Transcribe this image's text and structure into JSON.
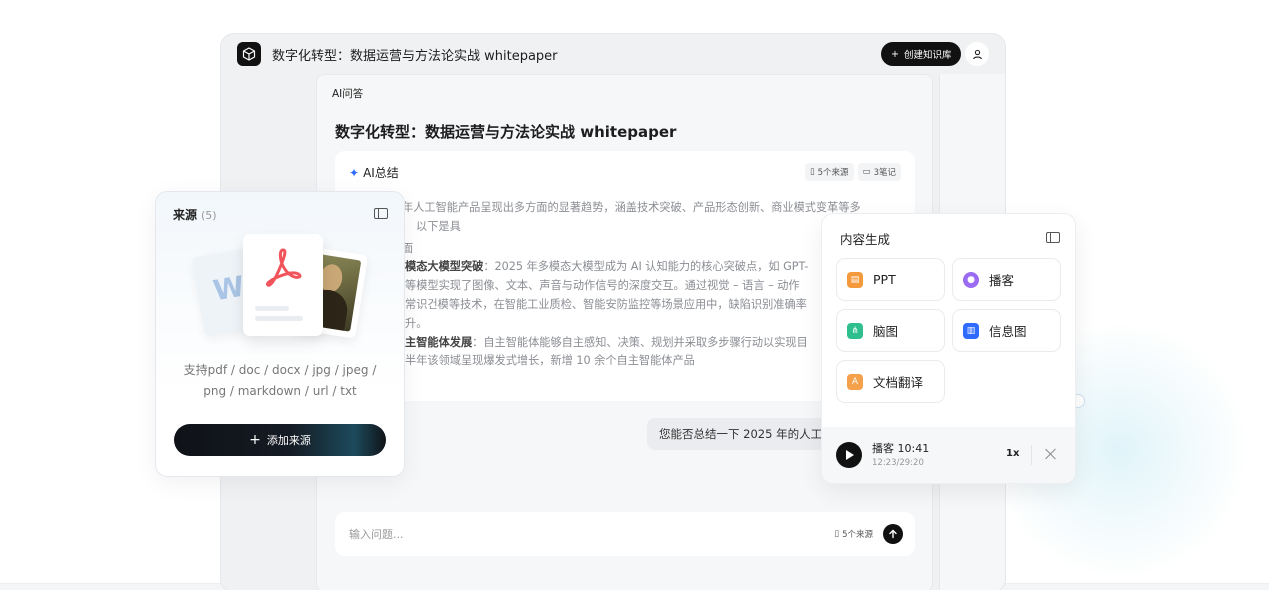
{
  "window": {
    "title": "数字化转型：数据运营与方法论实战 whitepaper",
    "create_button": "创建知识库"
  },
  "center": {
    "tab": "AI问答",
    "title": "数字化转型：数据运营与方法论实战 whitepaper",
    "summary": {
      "heading": "AI总结",
      "sources_pill": "5个来源",
      "notes_pill": "3笔记",
      "line1": "年人工智能产品呈现出多方面的显著趋势，涵盖技术突破、产品形态创新、商业模式变革等多",
      "line2": "以下是具",
      "line3": "面",
      "line4_bold": "模态大模型突破",
      "line4": "：2025 年多模态大模型成为 AI 认知能力的核心突破点，如 GPT-",
      "line5": "等模型实现了图像、文本、声音与动作信号的深度交互。通过视觉 – 语言 – 动作",
      "line6": "常识건模等技术，在智能工业质检、智能安防监控等场景应用中，缺陷识别准确率",
      "line7": "升。",
      "line8_bold": "主智能体发展",
      "line8": "：自主智能体能够自主感知、决策、规划并采取多步骤行动以实现目",
      "line9": "半年该领域呈现爆发式增长，新增 10 余个自主智能体产品"
    },
    "question": "您能否总结一下 2025 年的人工",
    "input": {
      "placeholder": "输入问题...",
      "sources_count": "5个来源"
    }
  },
  "sources": {
    "title": "来源",
    "count": "(5)",
    "support_line1": "支持pdf / doc / docx / jpg / jpeg /",
    "support_line2": "png / markdown / url / txt",
    "add_button": "添加来源"
  },
  "generation": {
    "title": "内容生成",
    "items": [
      {
        "label": "PPT",
        "icon": "ppt-icon",
        "color": "#f59a3c"
      },
      {
        "label": "播客",
        "icon": "microphone-icon",
        "color": "#9b6cf2"
      },
      {
        "label": "脑图",
        "icon": "mindmap-icon",
        "color": "#2fbf8f"
      },
      {
        "label": "信息图",
        "icon": "infographic-icon",
        "color": "#2f6bff"
      },
      {
        "label": "文档翻译",
        "icon": "translate-icon",
        "color": "#f5a04a"
      }
    ],
    "player": {
      "title": "播客 10:41",
      "time": "12:23/29:20",
      "speed": "1x"
    }
  },
  "colors": {
    "accent": "#2f6bff",
    "dark": "#111111"
  }
}
